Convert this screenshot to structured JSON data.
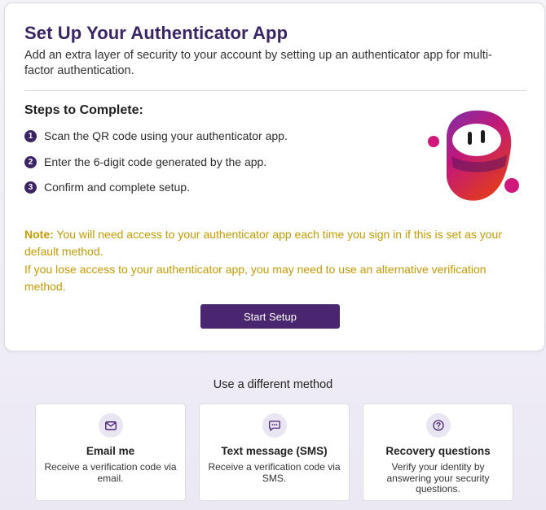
{
  "setup": {
    "title": "Set Up Your Authenticator App",
    "subtitle": "Add an extra layer of security to your account by setting up an authenticator app for multi-factor authentication.",
    "steps_title": "Steps to Complete:",
    "steps": [
      {
        "num": "1",
        "text": "Scan the QR code using your authenticator app."
      },
      {
        "num": "2",
        "text": "Enter the 6-digit code generated by the app."
      },
      {
        "num": "3",
        "text": "Confirm and complete setup."
      }
    ],
    "note_label": "Note:",
    "note_text": " You will need access to your authenticator app each time you sign in if this is set as your default method.",
    "note_text2": "If you lose access to your authenticator app, you may need to use an alternative verification method.",
    "start_button": "Start Setup"
  },
  "alternatives": {
    "title": "Use a different method",
    "methods": [
      {
        "icon": "mail-icon",
        "title": "Email me",
        "desc": "Receive a verification code via email."
      },
      {
        "icon": "message-icon",
        "title": "Text message (SMS)",
        "desc": "Receive a verification code via SMS."
      },
      {
        "icon": "question-icon",
        "title": "Recovery questions",
        "desc": "Verify your identity by answering your security questions."
      }
    ]
  },
  "colors": {
    "brand": "#3b2466",
    "button": "#4a2670",
    "note": "#c79a00"
  }
}
